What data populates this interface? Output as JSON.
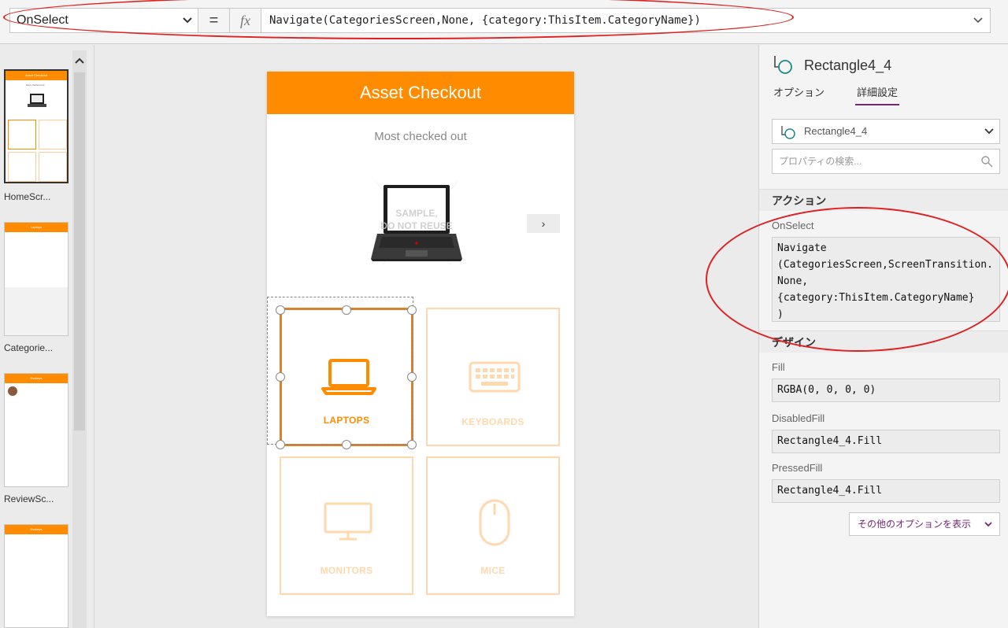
{
  "formula_bar": {
    "property": "OnSelect",
    "equals": "=",
    "fx": "fx",
    "formula": "Navigate(CategoriesScreen,None, {category:ThisItem.CategoryName})"
  },
  "screens": [
    {
      "label": "HomeScr...",
      "header": "Asset Checkout"
    },
    {
      "label": "Categorie...",
      "header": "Laptops"
    },
    {
      "label": "ReviewSc...",
      "header": "Reviews"
    },
    {
      "label": "",
      "header": "Reviews"
    }
  ],
  "app": {
    "title": "Asset Checkout",
    "subtitle": "Most checked out",
    "watermark_line1": "SAMPLE,",
    "watermark_line2": "DO NOT REUSE",
    "next": "›",
    "tiles": [
      {
        "label": "LAPTOPS",
        "icon": "laptop-icon"
      },
      {
        "label": "KEYBOARDS",
        "icon": "keyboard-icon"
      },
      {
        "label": "MONITORS",
        "icon": "monitor-icon"
      },
      {
        "label": "MICE",
        "icon": "mouse-icon"
      }
    ]
  },
  "props_panel": {
    "control_name": "Rectangle4_4",
    "tab_options": "オプション",
    "tab_advanced": "詳細設定",
    "select_value": "Rectangle4_4",
    "search_placeholder": "プロパティの検索...",
    "section_action": "アクション",
    "onselect_label": "OnSelect",
    "onselect_value": "Navigate\n(CategoriesScreen,ScreenTransition.None,\n{category:ThisItem.CategoryName}\n)",
    "section_design": "デザイン",
    "fill_label": "Fill",
    "fill_value": "RGBA(0, 0, 0, 0)",
    "disabledfill_label": "DisabledFill",
    "disabledfill_value": "Rectangle4_4.Fill",
    "pressedfill_label": "PressedFill",
    "pressedfill_value": "Rectangle4_4.Fill",
    "more_options": "その他のオプションを表示"
  },
  "colors": {
    "accent": "#ff8c00",
    "tile_faded": "#ffd9ad",
    "selection": "#d9822b",
    "annotation": "#e02020",
    "link": "#742774"
  }
}
